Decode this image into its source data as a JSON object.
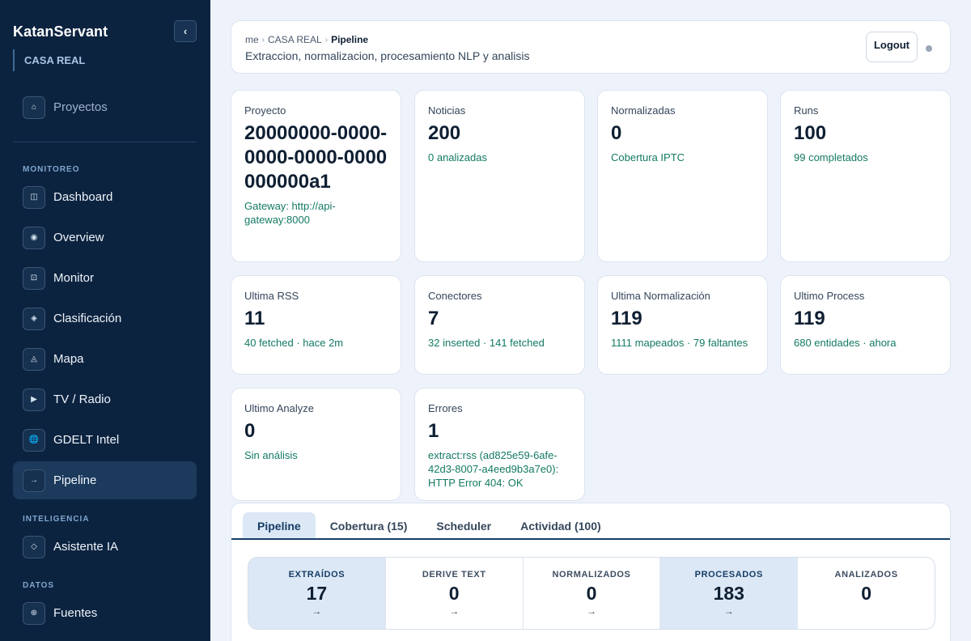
{
  "sidebar": {
    "brand": "KatanServant",
    "collapse_glyph": "‹",
    "org": "CASA REAL",
    "projects": {
      "label": "Proyectos",
      "icon": "home-icon",
      "glyph": "⌂"
    },
    "sections": {
      "monitoreo": "MONITOREO",
      "inteligencia": "INTELIGENCIA",
      "datos": "DATOS"
    },
    "items": [
      {
        "label": "Dashboard",
        "icon": "dashboard-icon",
        "glyph": "◫"
      },
      {
        "label": "Overview",
        "icon": "overview-icon",
        "glyph": "◉"
      },
      {
        "label": "Monitor",
        "icon": "monitor-icon",
        "glyph": "⊡"
      },
      {
        "label": "Clasificación",
        "icon": "classification-icon",
        "glyph": "◈"
      },
      {
        "label": "Mapa",
        "icon": "map-icon",
        "glyph": "◬"
      },
      {
        "label": "TV / Radio",
        "icon": "play-icon",
        "glyph": "▶"
      },
      {
        "label": "GDELT Intel",
        "icon": "globe-icon",
        "glyph": "🌐"
      },
      {
        "label": "Pipeline",
        "icon": "arrow-right-icon",
        "glyph": "→"
      },
      {
        "label": "Asistente IA",
        "icon": "diamond-icon",
        "glyph": "◇"
      },
      {
        "label": "Fuentes",
        "icon": "sources-icon",
        "glyph": "⊕"
      }
    ]
  },
  "header": {
    "breadcrumb": [
      "me",
      "CASA REAL",
      "Pipeline"
    ],
    "breadcrumb_sep": "›",
    "subtitle": "Extraccion, normalizacion, procesamiento NLP y analisis",
    "logout_label": "Logout"
  },
  "cards": [
    {
      "label": "Proyecto",
      "value": "20000000-0000-0000-0000-0000000000a1",
      "sub": "Gateway: http://api-gateway:8000"
    },
    {
      "label": "Noticias",
      "value": "200",
      "sub": "0 analizadas"
    },
    {
      "label": "Normalizadas",
      "value": "0",
      "sub": "Cobertura IPTC"
    },
    {
      "label": "Runs",
      "value": "100",
      "sub": "99 completados"
    },
    {
      "label": "Ultima RSS",
      "value": "11",
      "sub": "40 fetched · hace 2m"
    },
    {
      "label": "Conectores",
      "value": "7",
      "sub": "32 inserted · 141 fetched"
    },
    {
      "label": "Ultima Normalización",
      "value": "119",
      "sub": "1111 mapeados · 79 faltantes"
    },
    {
      "label": "Ultimo Process",
      "value": "119",
      "sub": "680 entidades · ahora"
    },
    {
      "label": "Ultimo Analyze",
      "value": "0",
      "sub": "Sin análisis"
    },
    {
      "label": "Errores",
      "value": "1",
      "sub": "extract:rss (ad825e59-6afe-42d3-8007-a4eed9b3a7e0): HTTP Error 404: OK"
    }
  ],
  "tabs": [
    {
      "label": "Pipeline",
      "active": true
    },
    {
      "label": "Cobertura (15)",
      "active": false
    },
    {
      "label": "Scheduler",
      "active": false
    },
    {
      "label": "Actividad (100)",
      "active": false
    }
  ],
  "stages": [
    {
      "name": "EXTRAÍDOS",
      "count": "17",
      "arrow": "→",
      "highlight": true
    },
    {
      "name": "DERIVE TEXT",
      "count": "0",
      "arrow": "→",
      "highlight": false
    },
    {
      "name": "NORMALIZADOS",
      "count": "0",
      "arrow": "→",
      "highlight": false
    },
    {
      "name": "PROCESADOS",
      "count": "183",
      "arrow": "→",
      "highlight": true
    },
    {
      "name": "ANALIZADOS",
      "count": "0",
      "arrow": "",
      "highlight": false
    }
  ],
  "colors": {
    "sidebar_bg": "#0c2340",
    "accent": "#163d66",
    "highlight_bg": "#dce8f5",
    "positive_text": "#137a63"
  }
}
